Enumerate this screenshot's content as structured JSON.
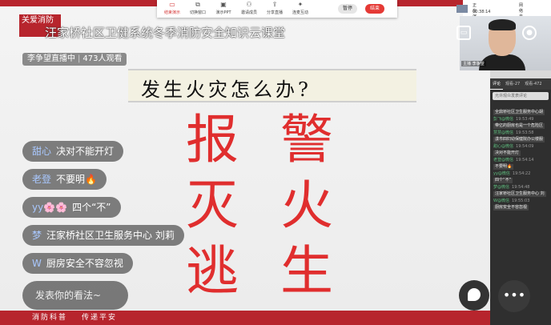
{
  "slide": {
    "brand_badge": "关爱消防",
    "course_title": "汪家桥社区卫健系统冬季消防安全知识云课堂",
    "question": "发生火灾怎么办?",
    "big_chars": [
      "报",
      "警",
      "灭",
      "火",
      "逃",
      "生"
    ],
    "footer_left": "消防科普",
    "footer_right": "传递平安"
  },
  "live": {
    "host_status": "李争望直播中",
    "viewers": "473人观看"
  },
  "danmu": [
    {
      "user": "甜心",
      "text": "决对不能开灯"
    },
    {
      "user": "老登",
      "text": "不要明🔥"
    },
    {
      "user": "yy🌸🌸",
      "text": "四个“不”"
    },
    {
      "user": "梦",
      "text": "汪家桥社区卫生服务中心 刘莉"
    },
    {
      "user": "W",
      "text": "厨房安全不容忽视"
    }
  ],
  "comment_input": {
    "placeholder": "发表你的看法~"
  },
  "toolbar": {
    "items": [
      "结束演示",
      "切换窗口",
      "演示PPT",
      "邀请成员",
      "分享直播",
      "连麦互动"
    ],
    "pause_label": "暂停",
    "end_label": "结束"
  },
  "status": {
    "presenter": "正在演示-桌面",
    "elapsed": "00:38:14",
    "network": "网络良好"
  },
  "camera": {
    "label": "主播 李争望"
  },
  "side_panel": {
    "tabs": [
      "评论",
      "观看-27",
      "观看-472"
    ],
    "input_placeholder": "允许观众发表评论",
    "comments": [
      {
        "name": "",
        "time": "",
        "text": "全鼎桥社区卫生服务中心胡"
      },
      {
        "name": "彭飞@微信",
        "time": "19:53:49",
        "text": "带亿的厨房也是一个危险区"
      },
      {
        "name": "慧慧@微信",
        "time": "19:53:58",
        "text": "漾市四妇幼保健院办公楼服"
      },
      {
        "name": "甜心@微信",
        "time": "19:54:09",
        "text": "决对不能开灯"
      },
      {
        "name": "老登@微信",
        "time": "19:54:14",
        "text": "不要明🔥"
      },
      {
        "name": "yy@微信",
        "time": "19:54:22",
        "text": "四个“不”"
      },
      {
        "name": "梦@微信",
        "time": "19:54:48",
        "text": "汪家桥社区卫生服务中心 刘"
      },
      {
        "name": "W@微信",
        "time": "19:55:03",
        "text": "厨房安全不容忽视"
      }
    ]
  },
  "icons": {
    "more": "more-icon",
    "chat": "chat-bubble-icon"
  }
}
